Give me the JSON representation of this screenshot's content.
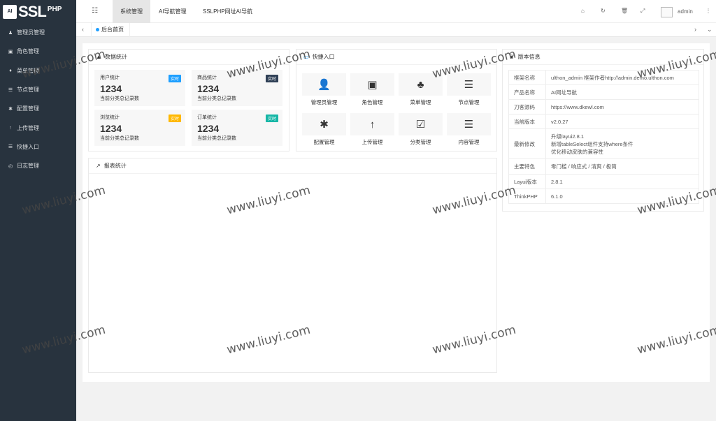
{
  "logo": {
    "mark": "AI",
    "text": "SSL",
    "sub": "PHP"
  },
  "sidebar": {
    "items": [
      {
        "icon": "user-icon",
        "glyph": "♟",
        "label": "管理员管理"
      },
      {
        "icon": "id-card-icon",
        "glyph": "▣",
        "label": "角色管理"
      },
      {
        "icon": "bell-icon",
        "glyph": "♦",
        "label": "菜单管理"
      },
      {
        "icon": "list-icon",
        "glyph": "☰",
        "label": "节点管理"
      },
      {
        "icon": "asterisk-icon",
        "glyph": "✱",
        "label": "配置管理"
      },
      {
        "icon": "arrow-up-icon",
        "glyph": "↑",
        "label": "上传管理"
      },
      {
        "icon": "list-icon",
        "glyph": "☰",
        "label": "快捷入口"
      },
      {
        "icon": "clock-icon",
        "glyph": "◴",
        "label": "日志管理"
      }
    ]
  },
  "header": {
    "tabs": [
      "系统管理",
      "AI导航管理",
      "SSLPHP网址AI导航"
    ],
    "admin": "admin"
  },
  "tabbar": {
    "page": "后台首页"
  },
  "stats_card": {
    "title": "数据统计",
    "items": [
      {
        "name": "用户统计",
        "badge": "实时",
        "badge_color": "#1e9fff",
        "value": "1234",
        "desc": "当前分类总记录数"
      },
      {
        "name": "商品统计",
        "badge": "实时",
        "badge_color": "#2f4056",
        "value": "1234",
        "desc": "当前分类总记录数"
      },
      {
        "name": "浏览统计",
        "badge": "实时",
        "badge_color": "#ffb800",
        "value": "1234",
        "desc": "当前分类总记录数"
      },
      {
        "name": "订单统计",
        "badge": "实时",
        "badge_color": "#16b6a6",
        "value": "1234",
        "desc": "当前分类总记录数"
      }
    ]
  },
  "quick_card": {
    "title": "快捷入口",
    "items": [
      {
        "icon": "user-icon",
        "glyph": "👤",
        "label": "管理员管理"
      },
      {
        "icon": "id-card-icon",
        "glyph": "▣",
        "label": "角色管理"
      },
      {
        "icon": "tree-icon",
        "glyph": "♣",
        "label": "菜单管理"
      },
      {
        "icon": "list-icon",
        "glyph": "☰",
        "label": "节点管理"
      },
      {
        "icon": "asterisk-icon",
        "glyph": "✱",
        "label": "配置管理"
      },
      {
        "icon": "arrow-up-icon",
        "glyph": "↑",
        "label": "上传管理"
      },
      {
        "icon": "calendar-check-icon",
        "glyph": "☑",
        "label": "分类管理"
      },
      {
        "icon": "list-icon",
        "glyph": "☰",
        "label": "内容管理"
      }
    ]
  },
  "report_card": {
    "title": "报表统计"
  },
  "version_card": {
    "title": "版本信息",
    "rows": [
      {
        "k": "框架名称",
        "v": "ulthon_admin 框架作者http://admin.demo.ulthon.com"
      },
      {
        "k": "产品名称",
        "v": "AI网址导航"
      },
      {
        "k": "刀客源码",
        "v": "https://www.dkewl.com"
      },
      {
        "k": "当前版本",
        "v": "v2.0.27"
      },
      {
        "k": "最新修改",
        "v": "升级layui2.8.1\n新增tableSelect组件支持where条件\n优化移动皮肤的兼容性"
      },
      {
        "k": "主要特色",
        "v": "零门槛 / 响应式 / 清爽 / 极简"
      },
      {
        "k": "Layui版本",
        "v": "2.8.1"
      },
      {
        "k": "ThinkPHP",
        "v": "6.1.0"
      }
    ]
  },
  "watermark": "www.liuyi.com"
}
